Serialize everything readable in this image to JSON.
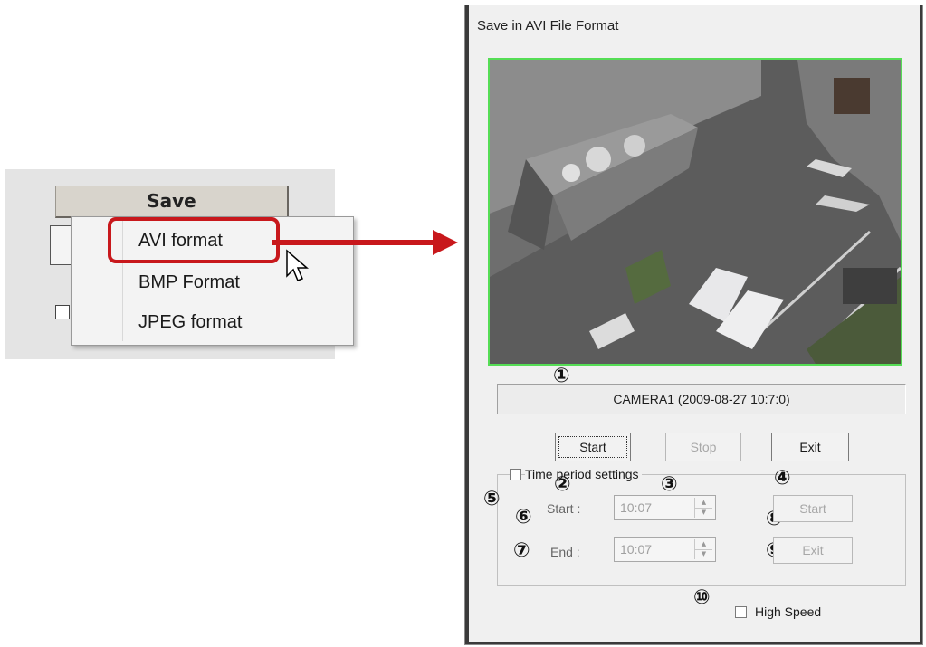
{
  "context_panel": {
    "save_button": "Save",
    "menu_items": [
      "AVI format",
      "BMP Format",
      "JPEG format"
    ]
  },
  "dialog": {
    "title": "Save in AVI File Format",
    "camera_caption": "CAMERA1 (2009-08-27  10:7:0)",
    "buttons": {
      "start": "Start",
      "stop": "Stop",
      "exit": "Exit"
    },
    "time_period": {
      "label": "Time period settings",
      "start_label": "Start :",
      "end_label": "End :",
      "start_value": "10:07",
      "end_value": "10:07",
      "start_button": "Start",
      "exit_button": "Exit"
    },
    "high_speed_label": "High Speed"
  },
  "callouts": [
    "①",
    "②",
    "③",
    "④",
    "⑤",
    "⑥",
    "⑦",
    "⑧",
    "⑨",
    "⑩"
  ],
  "colors": {
    "highlight": "#c8181c",
    "video_border": "#55dd55"
  }
}
